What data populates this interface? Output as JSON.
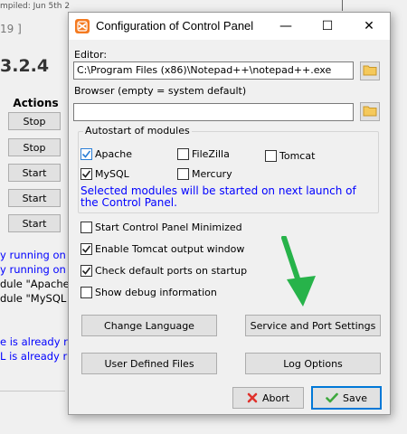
{
  "background": {
    "compiled": "mpiled: Jun 5th 2",
    "bracket": "19 ]",
    "version": "3.2.4",
    "actions_header": "Actions",
    "buttons": [
      "Stop",
      "Stop",
      "Start",
      "Start",
      "Start"
    ],
    "log_lines": [
      {
        "text": "y running on",
        "color": "blue"
      },
      {
        "text": "y running on",
        "color": "blue"
      },
      {
        "text": "dule \"Apache",
        "color": "black"
      },
      {
        "text": "dule \"MySQL",
        "color": "black"
      },
      {
        "text": "e is already r",
        "color": "blue"
      },
      {
        "text": "L is already r",
        "color": "blue"
      }
    ]
  },
  "dialog": {
    "title": "Configuration of Control Panel",
    "controls": {
      "minimize": "—",
      "maximize": "☐",
      "close": "✕"
    },
    "editor_label": "Editor:",
    "editor_value": "C:\\Program Files (x86)\\Notepad++\\notepad++.exe",
    "browser_label": "Browser (empty = system default)",
    "browser_value": "",
    "autostart": {
      "title": "Autostart of modules",
      "modules": [
        {
          "label": "Apache",
          "checked": true
        },
        {
          "label": "FileZilla",
          "checked": false
        },
        {
          "label": "Tomcat",
          "checked": false
        },
        {
          "label": "MySQL",
          "checked": true
        },
        {
          "label": "Mercury",
          "checked": false
        }
      ],
      "info": "Selected modules will be started on next launch of the Control Panel."
    },
    "options": [
      {
        "label": "Start Control Panel Minimized",
        "checked": false
      },
      {
        "label": "Enable Tomcat output window",
        "checked": true
      },
      {
        "label": "Check default ports on startup",
        "checked": true
      },
      {
        "label": "Show debug information",
        "checked": false
      }
    ],
    "buttons": {
      "change_language": "Change Language",
      "service_port": "Service and Port Settings",
      "user_files": "User Defined Files",
      "log_options": "Log Options",
      "abort": "Abort",
      "save": "Save"
    }
  },
  "colors": {
    "arrow": "#27b34a",
    "accent": "#0078d7",
    "info_text": "#0000ff",
    "app_icon": "#f47a20"
  }
}
